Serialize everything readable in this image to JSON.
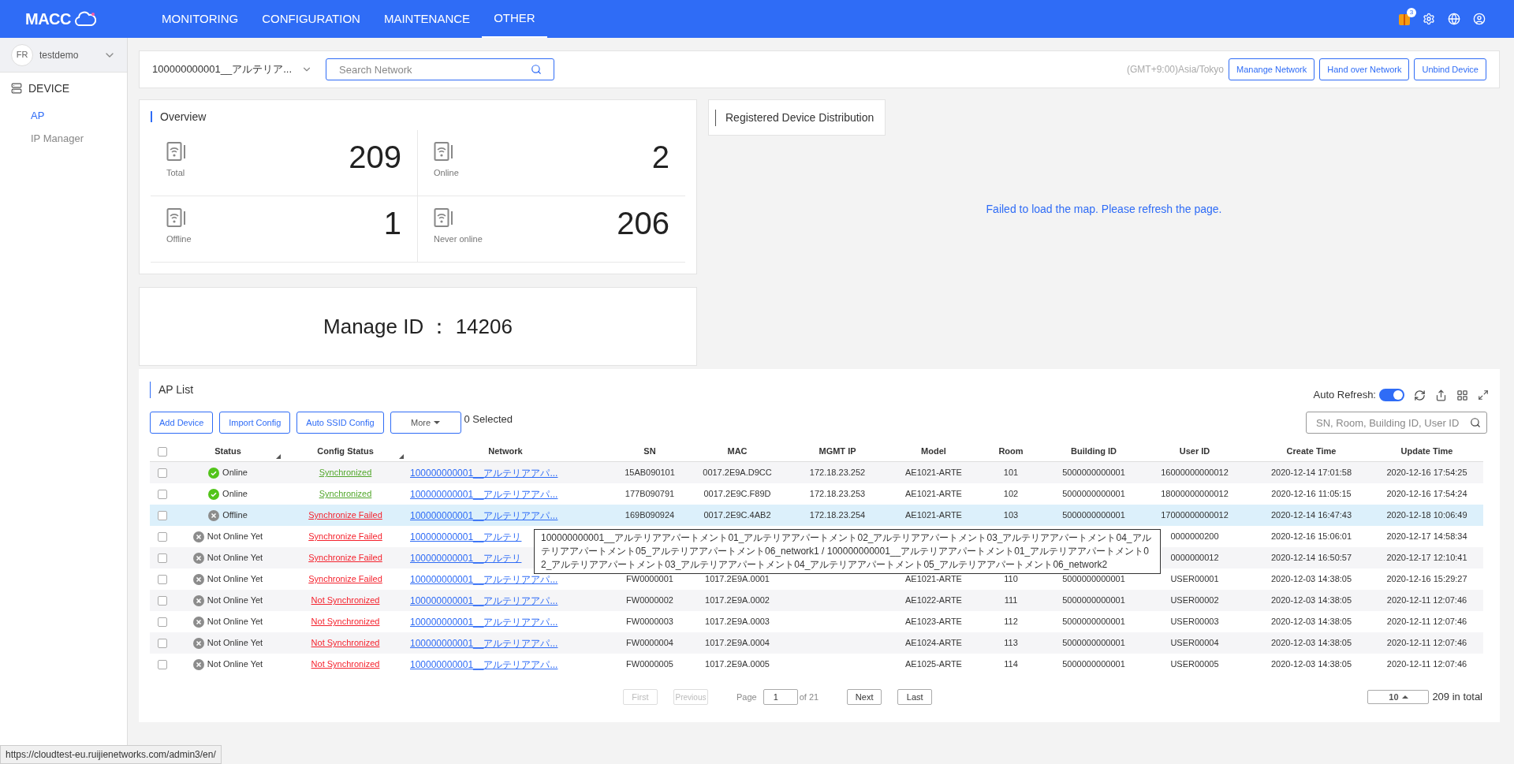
{
  "top_nav": {
    "logo": "MACC",
    "items": [
      {
        "label": "MONITORING",
        "selected": false
      },
      {
        "label": "CONFIGURATION",
        "selected": false
      },
      {
        "label": "MAINTENANCE",
        "selected": false
      },
      {
        "label": "OTHER",
        "selected": true
      }
    ],
    "notification_count": "3"
  },
  "sidebar": {
    "user": "testdemo",
    "user_initials": "FR",
    "section": "DEVICE",
    "items": [
      {
        "label": "AP",
        "selected": true
      },
      {
        "label": "IP Manager",
        "selected": false
      }
    ]
  },
  "network_bar": {
    "network": "100000000001__アルテリア...",
    "search_placeholder": "Search Network",
    "timezone": "(GMT+9:00)Asia/Tokyo",
    "buttons": [
      "Manange Network",
      "Hand over Network",
      "Unbind Device"
    ]
  },
  "overview": {
    "title": "Overview",
    "stats": [
      {
        "value": "209",
        "label": "Total"
      },
      {
        "value": "2",
        "label": "Online"
      },
      {
        "value": "1",
        "label": "Offline"
      },
      {
        "value": "206",
        "label": "Never online"
      }
    ]
  },
  "manage_id": "Manage ID ： 14206",
  "map": {
    "title": "Registered Device Distribution",
    "message": "Failed to load the map. Please refresh the page."
  },
  "ap_list": {
    "title": "AP List",
    "auto_refresh": {
      "label": "Auto Refresh:",
      "on": true
    },
    "buttons": [
      "Add Device",
      "Import Config",
      "Auto SSID Config"
    ],
    "more": "More",
    "selected_count": "0 Selected",
    "all_checked": false,
    "search_placeholder": "SN, Room, Building ID, User ID",
    "columns": [
      {
        "label": "Status",
        "sortable": true
      },
      {
        "label": "Config Status",
        "sortable": true
      },
      {
        "label": "Network",
        "sortable": false
      },
      {
        "label": "SN",
        "sortable": false
      },
      {
        "label": "MAC",
        "sortable": false
      },
      {
        "label": "MGMT IP",
        "sortable": false
      },
      {
        "label": "Model",
        "sortable": false
      },
      {
        "label": "Room",
        "sortable": false
      },
      {
        "label": "Building ID",
        "sortable": false
      },
      {
        "label": "User ID",
        "sortable": false
      },
      {
        "label": "Create Time",
        "sortable": false
      },
      {
        "label": "Update Time",
        "sortable": false
      }
    ],
    "rows": [
      {
        "checked": false,
        "hovered": false,
        "cells": [
          {
            "kind": "online",
            "label": "Online"
          },
          {
            "kind": "synced",
            "label": "Synchronized"
          },
          "100000000001__アルテリアアパ...",
          "15AB090101",
          "0017.2E9A.D9CC",
          "172.18.23.252",
          "AE1021-ARTE",
          "101",
          "5000000000001",
          "16000000000012",
          "2020-12-14 17:01:58",
          "2020-12-16 17:54:25"
        ]
      },
      {
        "checked": false,
        "hovered": false,
        "cells": [
          {
            "kind": "online",
            "label": "Online"
          },
          {
            "kind": "synced",
            "label": "Synchronized"
          },
          "100000000001__アルテリアアパ...",
          "177B090791",
          "0017.2E9C.F89D",
          "172.18.23.253",
          "AE1021-ARTE",
          "102",
          "5000000000001",
          "18000000000012",
          "2020-12-16 11:05:15",
          "2020-12-16 17:54:24"
        ]
      },
      {
        "checked": false,
        "hovered": true,
        "cells": [
          {
            "kind": "offline",
            "label": "Offline"
          },
          {
            "kind": "failed",
            "label": "Synchronize Failed"
          },
          "100000000001__アルテリアアパ...",
          "169B090924",
          "0017.2E9C.4AB2",
          "172.18.23.254",
          "AE1021-ARTE",
          "103",
          "5000000000001",
          "17000000000012",
          "2020-12-14 16:47:43",
          "2020-12-18 10:06:49"
        ]
      },
      {
        "checked": false,
        "hovered": false,
        "cells": [
          {
            "kind": "offline",
            "label": "Not Online Yet"
          },
          {
            "kind": "failed",
            "label": "Synchronize Failed"
          },
          "100000000001__アルテリ",
          null,
          null,
          null,
          null,
          null,
          null,
          "0000000200",
          "2020-12-16 15:06:01",
          "2020-12-17 14:58:34"
        ]
      },
      {
        "checked": false,
        "hovered": false,
        "cells": [
          {
            "kind": "offline",
            "label": "Not Online Yet"
          },
          {
            "kind": "failed",
            "label": "Synchronize Failed"
          },
          "100000000001__アルテリ",
          null,
          null,
          null,
          null,
          null,
          null,
          "0000000012",
          "2020-12-14 16:50:57",
          "2020-12-17 12:10:41"
        ]
      },
      {
        "checked": false,
        "hovered": false,
        "cells": [
          {
            "kind": "offline",
            "label": "Not Online Yet"
          },
          {
            "kind": "failed",
            "label": "Synchronize Failed"
          },
          "100000000001__アルテリアアパ...",
          "FW0000001",
          "1017.2E9A.0001",
          null,
          "AE1021-ARTE",
          "110",
          "5000000000001",
          "USER00001",
          "2020-12-03 14:38:05",
          "2020-12-16 15:29:27"
        ]
      },
      {
        "checked": false,
        "hovered": false,
        "cells": [
          {
            "kind": "offline",
            "label": "Not Online Yet"
          },
          {
            "kind": "unsynced",
            "label": "Not Synchronized"
          },
          "100000000001__アルテリアアパ...",
          "FW0000002",
          "1017.2E9A.0002",
          null,
          "AE1022-ARTE",
          "111",
          "5000000000001",
          "USER00002",
          "2020-12-03 14:38:05",
          "2020-12-11 12:07:46"
        ]
      },
      {
        "checked": false,
        "hovered": false,
        "cells": [
          {
            "kind": "offline",
            "label": "Not Online Yet"
          },
          {
            "kind": "unsynced",
            "label": "Not Synchronized"
          },
          "100000000001__アルテリアアパ...",
          "FW0000003",
          "1017.2E9A.0003",
          null,
          "AE1023-ARTE",
          "112",
          "5000000000001",
          "USER00003",
          "2020-12-03 14:38:05",
          "2020-12-11 12:07:46"
        ]
      },
      {
        "checked": false,
        "hovered": false,
        "cells": [
          {
            "kind": "offline",
            "label": "Not Online Yet"
          },
          {
            "kind": "unsynced",
            "label": "Not Synchronized"
          },
          "100000000001__アルテリアアパ...",
          "FW0000004",
          "1017.2E9A.0004",
          null,
          "AE1024-ARTE",
          "113",
          "5000000000001",
          "USER00004",
          "2020-12-03 14:38:05",
          "2020-12-11 12:07:46"
        ]
      },
      {
        "checked": false,
        "hovered": false,
        "cells": [
          {
            "kind": "offline",
            "label": "Not Online Yet"
          },
          {
            "kind": "unsynced",
            "label": "Not Synchronized"
          },
          "100000000001__アルテリアアパ...",
          "FW0000005",
          "1017.2E9A.0005",
          null,
          "AE1025-ARTE",
          "114",
          "5000000000001",
          "USER00005",
          "2020-12-03 14:38:05",
          "2020-12-11 12:07:46"
        ]
      }
    ],
    "tooltip": "100000000001__アルテリアアパートメント01_アルテリアアパートメント02_アルテリアアパートメント03_アルテリアアパートメント04_アルテリアアパートメント05_アルテリアアパートメント06_network1 / 100000000001__アルテリアアパートメント01_アルテリアアパートメント02_アルテリアアパートメント03_アルテリアアパートメント04_アルテリアアパートメント05_アルテリアアパートメント06_network2",
    "pagination": {
      "first": "First",
      "previous": "Previous",
      "page_label": "Page",
      "page": "1",
      "of": "of 21",
      "next": "Next",
      "last": "Last",
      "page_size": "10",
      "total": "209 in total"
    }
  },
  "status_url": "https://cloudtest-eu.ruijienetworks.com/admin3/en/"
}
